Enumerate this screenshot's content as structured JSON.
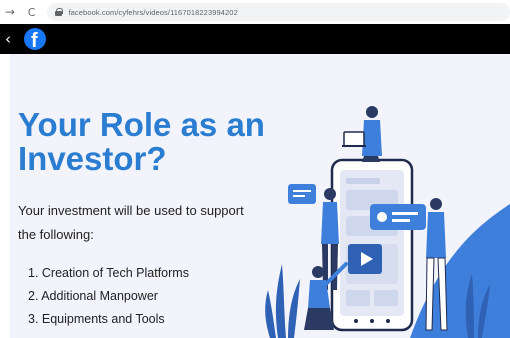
{
  "browser": {
    "back_icon": "arrow-left-icon",
    "forward_icon": "arrow-right-icon",
    "reload_icon": "reload-icon",
    "url": "facebook.com/cyfehrs/videos/1167018223994202"
  },
  "facebook": {
    "close_icon": "close-icon",
    "logo_letter": "f",
    "brand_color": "#1877f2"
  },
  "slide": {
    "title_line1": "Your Role as an",
    "title_line2": "Investor?",
    "intro_line1": "Your investment will be used to support",
    "intro_line2": "the following:",
    "items": [
      "1. Creation of Tech Platforms",
      "2. Additional Manpower",
      "3. Equipments and Tools"
    ],
    "title_color": "#2a7dd1",
    "accent_color": "#3f7fdc"
  }
}
